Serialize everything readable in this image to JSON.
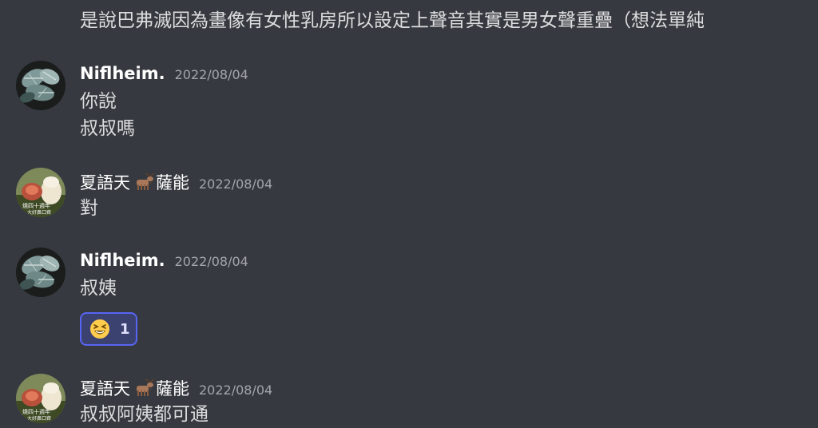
{
  "top_message": {
    "text": "是說巴弗滅因為畫像有女性乳房所以設定上聲音其實是男女聲重疊（想法單純"
  },
  "messages": [
    {
      "username": "Niflheim.",
      "timestamp": "2022/08/04",
      "avatar": "plant-leaves-avatar",
      "lines": [
        "你說",
        "叔叔嗎"
      ]
    },
    {
      "username_part1": "夏語天",
      "username_part2": "薩能",
      "username_emoji": "goat-emoji",
      "timestamp": "2022/08/04",
      "avatar": "goat-figurine-avatar",
      "lines": [
        "對"
      ]
    },
    {
      "username": "Niflheim.",
      "timestamp": "2022/08/04",
      "avatar": "plant-leaves-avatar",
      "lines": [
        "叔姨"
      ],
      "reaction": {
        "emoji": "grinning-squinting-face",
        "count": "1"
      }
    },
    {
      "username_part1": "夏語天",
      "username_part2": "薩能",
      "username_emoji": "goat-emoji",
      "timestamp": "2022/08/04",
      "avatar": "goat-figurine-avatar",
      "lines": [
        "叔叔阿姨都可通"
      ]
    }
  ],
  "colors": {
    "background": "#36393f",
    "text": "#dcddde",
    "timestamp": "#a3a6aa",
    "reaction_border": "#5865f2",
    "reaction_bg": "#3c4270"
  }
}
